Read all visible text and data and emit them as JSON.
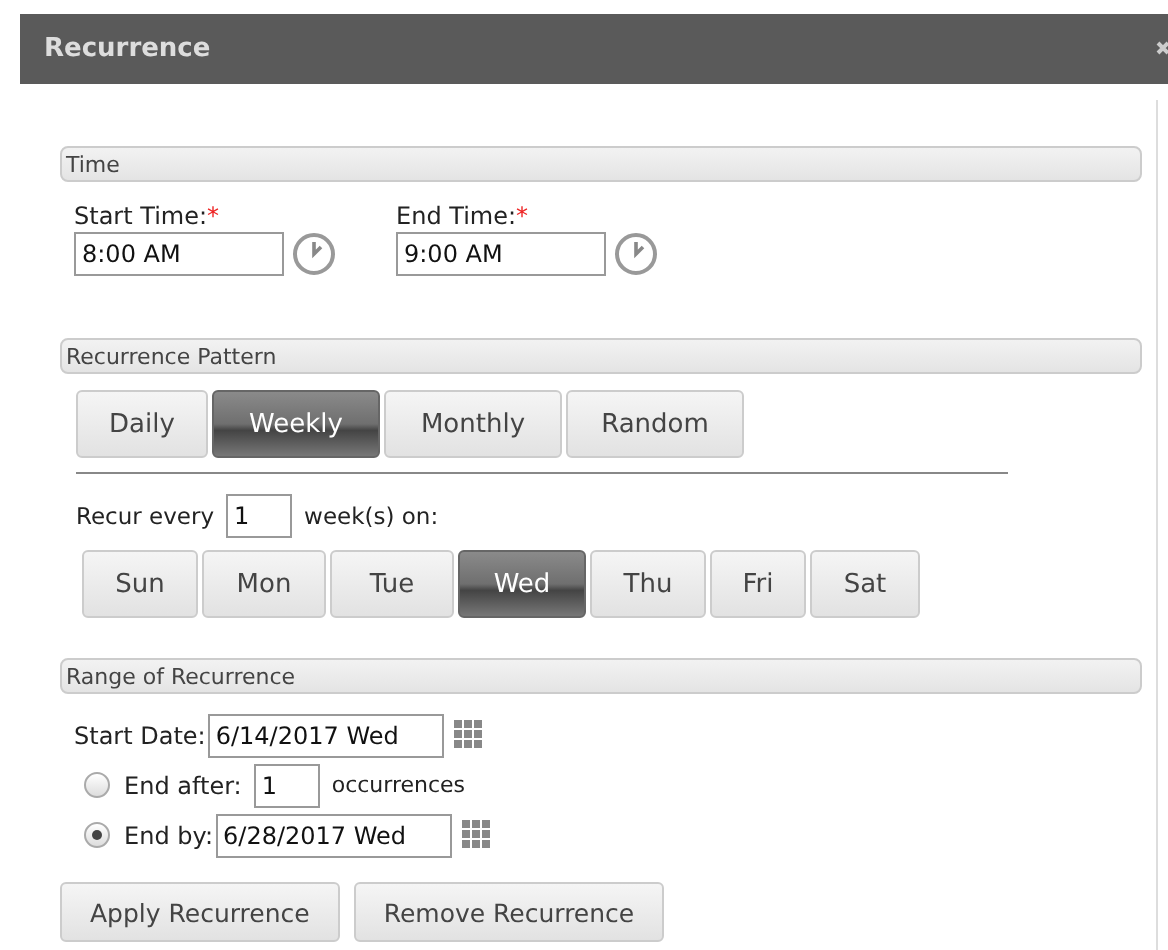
{
  "window": {
    "title": "Recurrence"
  },
  "time": {
    "header": "Time",
    "fields": [
      {
        "label": "Start Time:",
        "required": "*",
        "value": "8:00 AM"
      },
      {
        "label": "End Time:",
        "required": "*",
        "value": "9:00 AM"
      }
    ]
  },
  "pattern": {
    "header": "Recurrence Pattern",
    "tabs": [
      {
        "label": "Daily",
        "selected": false
      },
      {
        "label": "Weekly",
        "selected": true
      },
      {
        "label": "Monthly",
        "selected": false
      },
      {
        "label": "Random",
        "selected": false
      }
    ],
    "recur_label": "Recur every",
    "recur_value": "1",
    "recur_suffix": "week(s) on:",
    "days": [
      {
        "label": "Sun",
        "selected": false
      },
      {
        "label": "Mon",
        "selected": false
      },
      {
        "label": "Tue",
        "selected": false
      },
      {
        "label": "Wed",
        "selected": true
      },
      {
        "label": "Thu",
        "selected": false
      },
      {
        "label": "Fri",
        "selected": false
      },
      {
        "label": "Sat",
        "selected": false
      }
    ]
  },
  "range": {
    "header": "Range of Recurrence",
    "start_label": "Start Date:",
    "start_value": "6/14/2017 Wed",
    "options": [
      {
        "kind": "count",
        "label": "End after:",
        "value": "1",
        "suffix": "occurrences",
        "selected": false
      },
      {
        "kind": "date",
        "label": "End by:",
        "value": "6/28/2017 Wed",
        "selected": true
      }
    ]
  },
  "buttons": [
    "Apply Recurrence",
    "Remove Recurrence"
  ]
}
